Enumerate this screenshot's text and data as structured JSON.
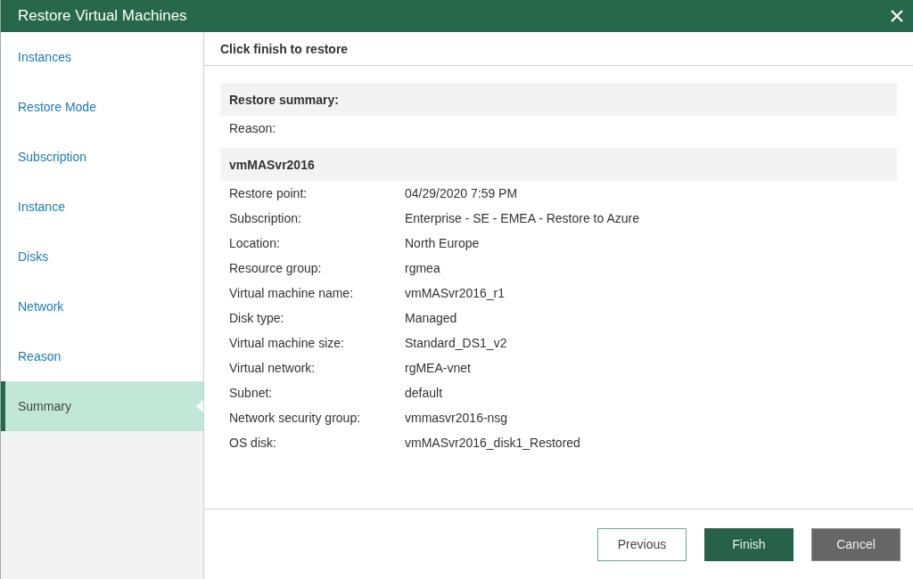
{
  "window": {
    "title": "Restore Virtual Machines"
  },
  "steps": [
    {
      "label": "Instances",
      "selected": false
    },
    {
      "label": "Restore Mode",
      "selected": false
    },
    {
      "label": "Subscription",
      "selected": false
    },
    {
      "label": "Instance",
      "selected": false
    },
    {
      "label": "Disks",
      "selected": false
    },
    {
      "label": "Network",
      "selected": false
    },
    {
      "label": "Reason",
      "selected": false
    },
    {
      "label": "Summary",
      "selected": true
    }
  ],
  "main": {
    "heading": "Click finish to restore",
    "summary_title": "Restore summary:",
    "reason_label": "Reason:",
    "vm_name": "vmMASvr2016",
    "rows": [
      {
        "label": "Restore point:",
        "value": "04/29/2020 7:59 PM"
      },
      {
        "label": "Subscription:",
        "value": "Enterprise - SE - EMEA - Restore to Azure"
      },
      {
        "label": "Location:",
        "value": "North Europe"
      },
      {
        "label": "Resource group:",
        "value": "rgmea"
      },
      {
        "label": "Virtual machine name:",
        "value": "vmMASvr2016_r1"
      },
      {
        "label": "Disk type:",
        "value": "Managed"
      },
      {
        "label": "Virtual machine size:",
        "value": "Standard_DS1_v2"
      },
      {
        "label": "Virtual network:",
        "value": "rgMEA-vnet"
      },
      {
        "label": "Subnet:",
        "value": "default"
      },
      {
        "label": "Network security group:",
        "value": "vmmasvr2016-nsg"
      },
      {
        "label": "OS disk:",
        "value": "vmMASvr2016_disk1_Restored"
      }
    ]
  },
  "buttons": [
    {
      "label": "Previous",
      "kind": "outline"
    },
    {
      "label": "Finish",
      "kind": "primary"
    },
    {
      "label": "Cancel",
      "kind": "secondary"
    }
  ]
}
